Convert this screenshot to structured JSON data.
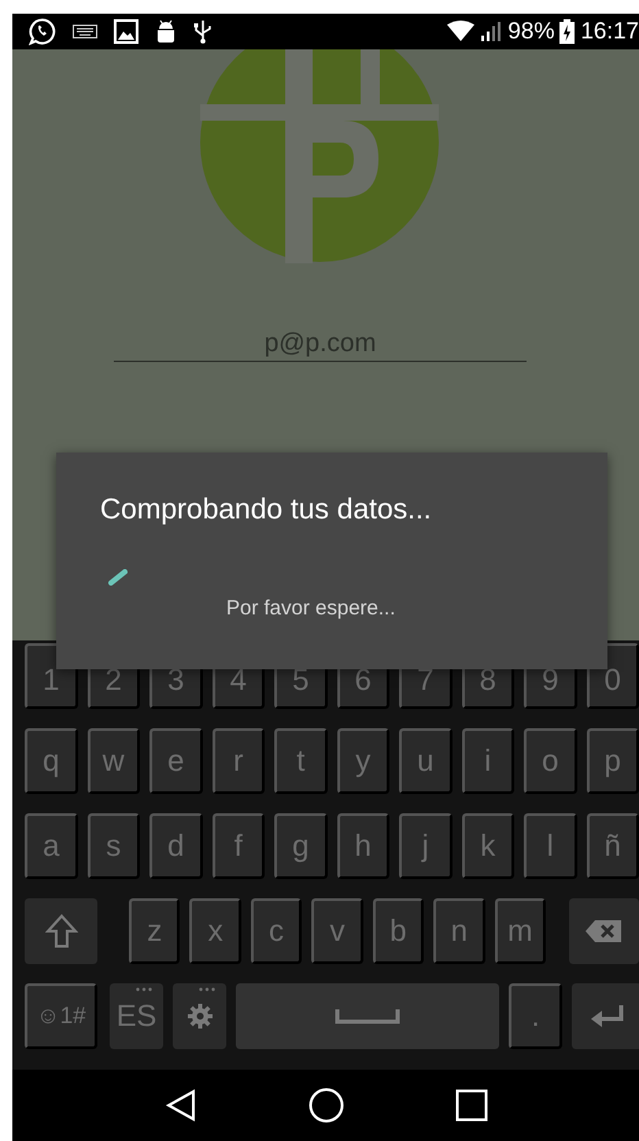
{
  "status_bar": {
    "battery": "98%",
    "time": "16:17"
  },
  "login": {
    "email": "p@p.com"
  },
  "dialog": {
    "title": "Comprobando tus datos...",
    "message": "Por favor espere..."
  },
  "keyboard": {
    "rows": [
      [
        {
          "kind": "char",
          "label": "1"
        },
        {
          "kind": "char",
          "label": "2"
        },
        {
          "kind": "char",
          "label": "3"
        },
        {
          "kind": "char",
          "label": "4"
        },
        {
          "kind": "char",
          "label": "5"
        },
        {
          "kind": "char",
          "label": "6"
        },
        {
          "kind": "char",
          "label": "7"
        },
        {
          "kind": "char",
          "label": "8"
        },
        {
          "kind": "char",
          "label": "9"
        },
        {
          "kind": "char",
          "label": "0"
        }
      ],
      [
        {
          "kind": "char",
          "label": "q"
        },
        {
          "kind": "char",
          "label": "w"
        },
        {
          "kind": "char",
          "label": "e"
        },
        {
          "kind": "char",
          "label": "r"
        },
        {
          "kind": "char",
          "label": "t"
        },
        {
          "kind": "char",
          "label": "y"
        },
        {
          "kind": "char",
          "label": "u"
        },
        {
          "kind": "char",
          "label": "i"
        },
        {
          "kind": "char",
          "label": "o"
        },
        {
          "kind": "char",
          "label": "p"
        }
      ],
      [
        {
          "kind": "char",
          "label": "a"
        },
        {
          "kind": "char",
          "label": "s"
        },
        {
          "kind": "char",
          "label": "d"
        },
        {
          "kind": "char",
          "label": "f"
        },
        {
          "kind": "char",
          "label": "g"
        },
        {
          "kind": "char",
          "label": "h"
        },
        {
          "kind": "char",
          "label": "j"
        },
        {
          "kind": "char",
          "label": "k"
        },
        {
          "kind": "char",
          "label": "l"
        },
        {
          "kind": "char",
          "label": "ñ"
        }
      ],
      [
        {
          "kind": "shift"
        },
        {
          "kind": "char",
          "label": "z"
        },
        {
          "kind": "char",
          "label": "x"
        },
        {
          "kind": "char",
          "label": "c"
        },
        {
          "kind": "char",
          "label": "v"
        },
        {
          "kind": "char",
          "label": "b"
        },
        {
          "kind": "char",
          "label": "n"
        },
        {
          "kind": "char",
          "label": "m"
        },
        {
          "kind": "backspace"
        }
      ],
      [
        {
          "kind": "symbols",
          "label": "☺1#"
        },
        {
          "kind": "lang",
          "label": "ES"
        },
        {
          "kind": "settings"
        },
        {
          "kind": "space"
        },
        {
          "kind": "char",
          "label": "."
        },
        {
          "kind": "enter"
        }
      ]
    ]
  }
}
